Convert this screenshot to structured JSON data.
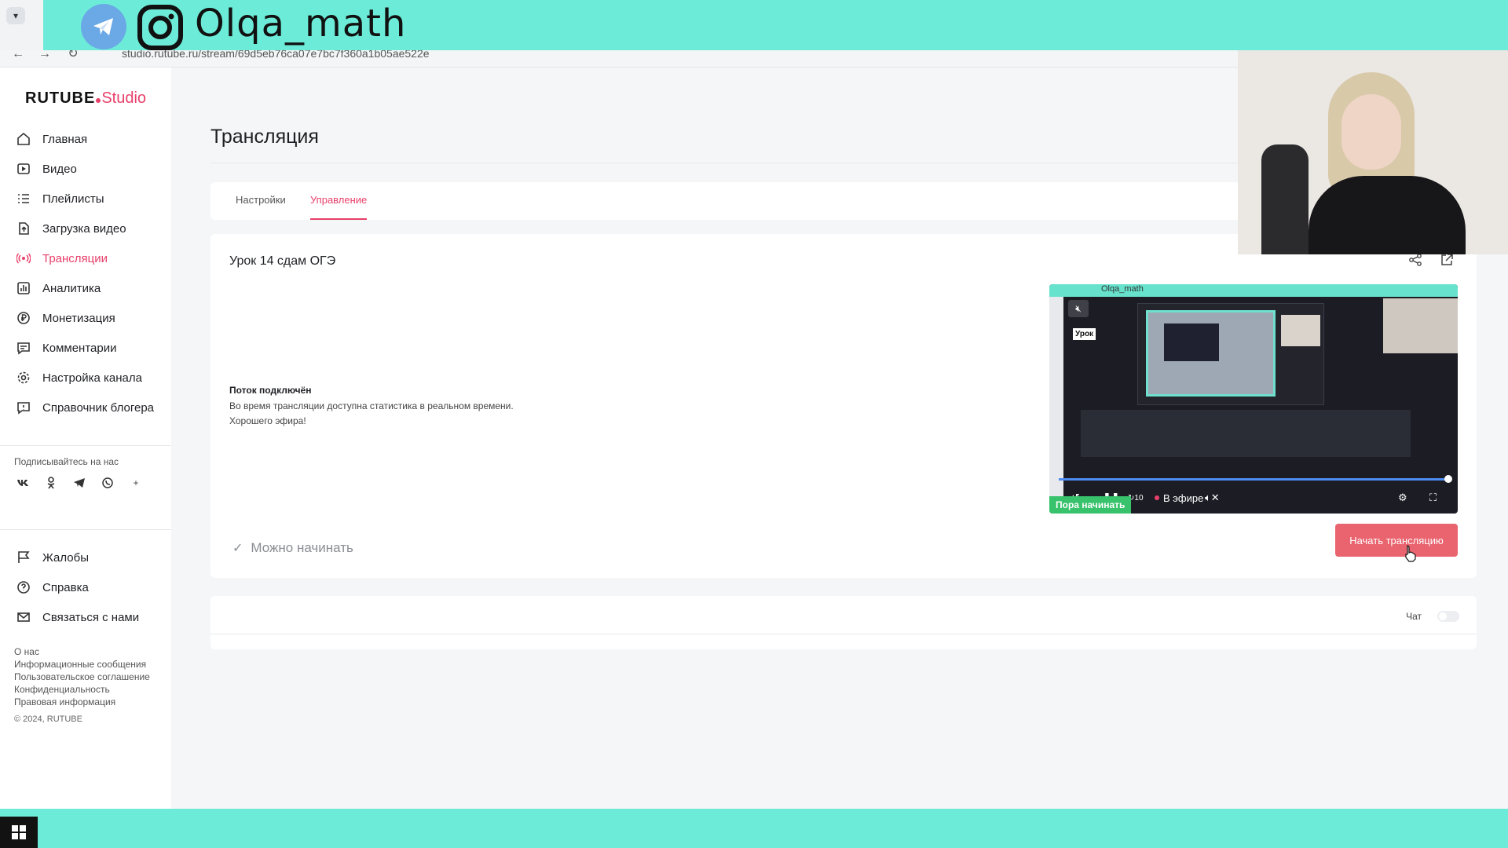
{
  "overlay": {
    "handle": "Olqa_math",
    "handle_small": "Olqa_math"
  },
  "browser": {
    "url": "studio.rutube.ru/stream/69d5eb76ca07e7bc7f360a1b05ae522e"
  },
  "logo": {
    "main": "RUTUBE",
    "studio": "Studio"
  },
  "sidebar": {
    "items": [
      {
        "label": "Главная",
        "icon": "home-icon"
      },
      {
        "label": "Видео",
        "icon": "video-icon"
      },
      {
        "label": "Плейлисты",
        "icon": "list-icon"
      },
      {
        "label": "Загрузка видео",
        "icon": "upload-icon"
      },
      {
        "label": "Трансляции",
        "icon": "broadcast-icon",
        "active": true
      },
      {
        "label": "Аналитика",
        "icon": "chart-icon"
      },
      {
        "label": "Монетизация",
        "icon": "ruble-icon"
      },
      {
        "label": "Комментарии",
        "icon": "comment-icon"
      },
      {
        "label": "Настройка канала",
        "icon": "gear-icon"
      },
      {
        "label": "Справочник блогера",
        "icon": "info-icon"
      }
    ],
    "subscribe_title": "Подписывайтесь на нас",
    "socials": [
      "vk-icon",
      "ok-icon",
      "telegram-icon",
      "viber-icon",
      "plus-icon"
    ],
    "secondary": [
      {
        "label": "Жалобы",
        "icon": "flag-icon"
      },
      {
        "label": "Справка",
        "icon": "question-icon"
      },
      {
        "label": "Связаться с нами",
        "icon": "mail-icon"
      }
    ],
    "footer_links": [
      "О нас",
      "Информационные сообщения",
      "Пользовательское соглашение",
      "Конфиденциальность",
      "Правовая информация"
    ],
    "copyright": "© 2024, RUTUBE"
  },
  "main": {
    "title": "Трансляция",
    "tabs": [
      {
        "label": "Настройки",
        "active": false
      },
      {
        "label": "Управление",
        "active": true
      }
    ],
    "stream_title": "Урок 14 сдам ОГЭ",
    "status_title": "Поток подключён",
    "status_lines": [
      "Во время трансляции доступна статистика в реальном времени.",
      "Хорошего эфира!"
    ],
    "ready_label": "Можно начинать",
    "start_button": "Начать трансляцию",
    "chat_label": "Чат"
  },
  "player": {
    "inner_lesson_label": "Урок",
    "live_label": "В эфире",
    "time_badge": "Пора начинать",
    "skip_seconds": "10",
    "progress_fraction": 1.0
  },
  "colors": {
    "accent": "#e8406a",
    "start_button": "#e9646f",
    "overlay": "#6cecd8",
    "badge_green": "#37c26b"
  }
}
